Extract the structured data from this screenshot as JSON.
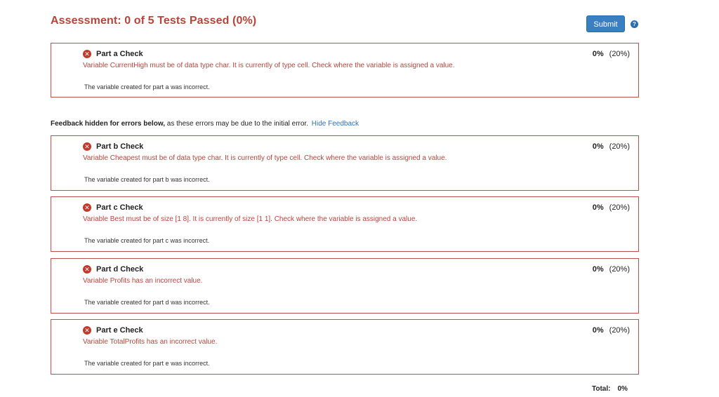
{
  "header": {
    "title": "Assessment: 0 of 5 Tests Passed (0%)",
    "submit_label": "Submit",
    "help_glyph": "?"
  },
  "checks": [
    {
      "title": "Part a Check",
      "percent": "0%",
      "weight": "(20%)",
      "message": "Variable CurrentHigh must be of data type char. It is currently of type cell. Check where the variable is assigned a value.",
      "note": "The variable created for part a was incorrect."
    },
    {
      "title": "Part b Check",
      "percent": "0%",
      "weight": "(20%)",
      "message": "Variable Cheapest must be of data type char. It is currently of type cell. Check where the variable is assigned a value.",
      "note": "The variable created for part b was incorrect."
    },
    {
      "title": "Part c Check",
      "percent": "0%",
      "weight": "(20%)",
      "message": "Variable Best must be of size [1 8]. It is currently of size [1 1]. Check where the variable is assigned a value.",
      "note": "The variable created for part c was incorrect."
    },
    {
      "title": "Part d Check",
      "percent": "0%",
      "weight": "(20%)",
      "message": "Variable Profits has an incorrect value.",
      "note": "The variable created for part d was incorrect."
    },
    {
      "title": "Part e Check",
      "percent": "0%",
      "weight": "(20%)",
      "message": "Variable TotalProfits has an incorrect value.",
      "note": "The variable created for part e was incorrect."
    }
  ],
  "feedback": {
    "bold_text": "Feedback hidden for errors below,",
    "rest_text": " as these errors may be due to the initial error.",
    "link_text": "Hide Feedback"
  },
  "total": {
    "label": "Total:",
    "value": "0%"
  },
  "colors": {
    "title_red": "#b5453a",
    "border_red": "#c0504d",
    "error_icon_red": "#c0392b",
    "submit_blue": "#3a7fc2",
    "link_blue": "#2f6fae"
  },
  "icons": {
    "error": "x-circle-icon",
    "help": "question-circle-icon"
  }
}
